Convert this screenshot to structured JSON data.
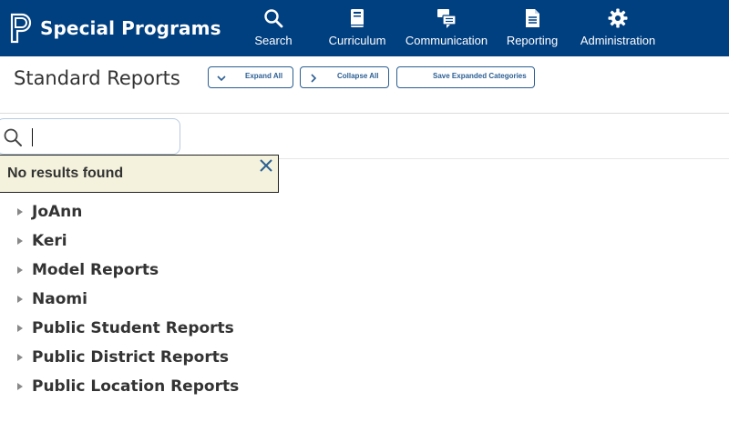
{
  "app": {
    "title": "Special Programs"
  },
  "colors": {
    "nav_bg": "#003f80",
    "accent": "#2c5f93",
    "popup_bg": "#f4f2dc"
  },
  "nav": [
    {
      "label": "Search",
      "icon": "search-icon"
    },
    {
      "label": "Curriculum",
      "icon": "book-icon"
    },
    {
      "label": "Communication",
      "icon": "chat-icon"
    },
    {
      "label": "Reporting",
      "icon": "document-icon"
    },
    {
      "label": "Administration",
      "icon": "gear-icon"
    }
  ],
  "page": {
    "title": "Standard Reports"
  },
  "toolbar": {
    "expand_all": "Expand All",
    "collapse_all": "Collapse All",
    "save_expanded": "Save Expanded Categories"
  },
  "search": {
    "value": "",
    "placeholder": ""
  },
  "popup": {
    "message": "No results found"
  },
  "categories": [
    {
      "label": "JoAnn"
    },
    {
      "label": "Keri"
    },
    {
      "label": "Model Reports"
    },
    {
      "label": "Naomi"
    },
    {
      "label": "Public Student Reports"
    },
    {
      "label": "Public District Reports"
    },
    {
      "label": "Public Location Reports"
    }
  ]
}
